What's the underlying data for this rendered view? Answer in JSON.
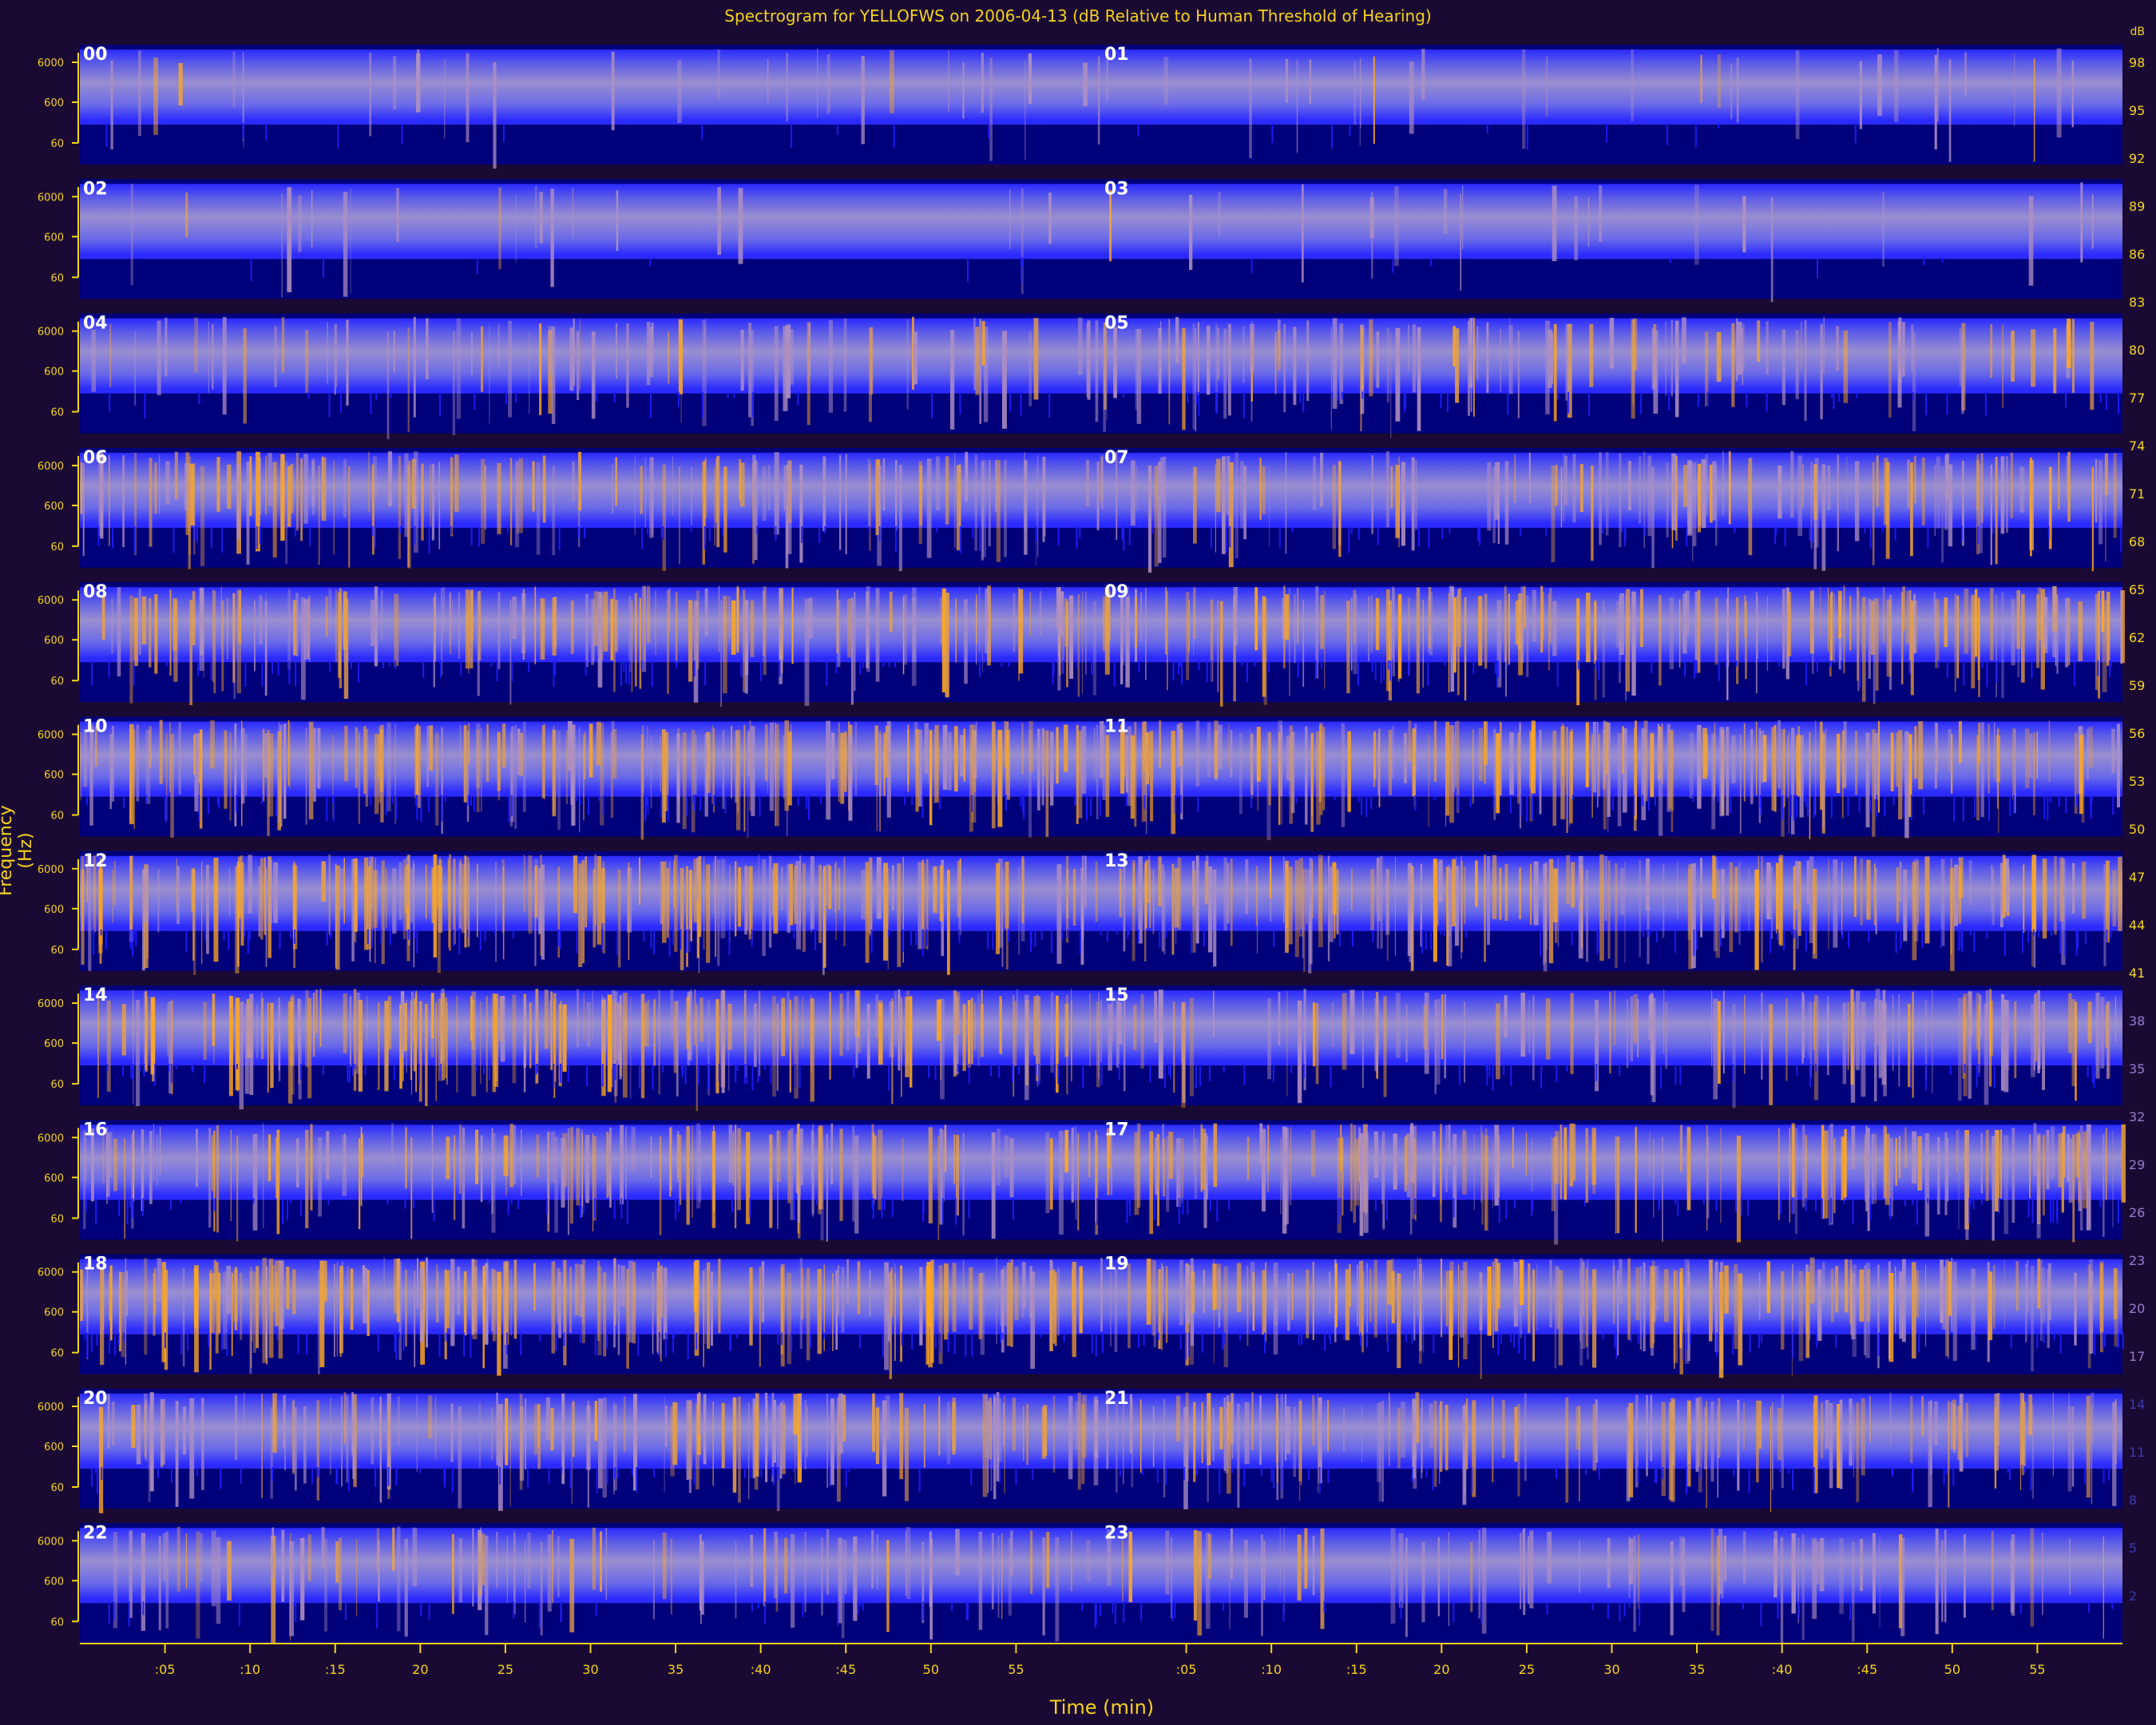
{
  "chart_data": {
    "type": "heatmap",
    "title": "Spectrogram for YELLOFWS on 2006-04-13 (dB Relative to Human Threshold of Hearing)",
    "xlabel": "Time (min)",
    "ylabel": "Frequency (Hz)",
    "x_tick_labels": [
      ":05",
      ":10",
      ":15",
      "20",
      "25",
      "30",
      "35",
      ":40",
      ":45",
      "50",
      "55"
    ],
    "y_tick_labels": [
      "6000",
      "600",
      "60"
    ],
    "hour_labels": [
      "00",
      "01",
      "02",
      "03",
      "04",
      "05",
      "06",
      "07",
      "08",
      "09",
      "10",
      "11",
      "12",
      "13",
      "14",
      "15",
      "16",
      "17",
      "18",
      "19",
      "20",
      "21",
      "22",
      "23"
    ],
    "hour_activity": [
      0.12,
      0.12,
      0.08,
      0.08,
      0.3,
      0.42,
      0.55,
      0.5,
      0.62,
      0.68,
      0.76,
      0.78,
      0.8,
      0.72,
      0.82,
      0.48,
      0.56,
      0.66,
      0.74,
      0.7,
      0.58,
      0.56,
      0.36,
      0.3
    ],
    "colorbar": {
      "unit": "dB",
      "tick_labels": [
        "98",
        "95",
        "92",
        "89",
        "86",
        "83",
        "80",
        "77",
        "74",
        "71",
        "68",
        "65",
        "62",
        "59",
        "56",
        "53",
        "50",
        "47",
        "44",
        "41",
        "38",
        "35",
        "32",
        "29",
        "26",
        "23",
        "20",
        "17",
        "14",
        "11",
        "8",
        "5",
        "2"
      ],
      "colors": [
        "#000066",
        "#1b1bff",
        "#8080e0",
        "#c8a070",
        "#ffb020"
      ]
    }
  }
}
